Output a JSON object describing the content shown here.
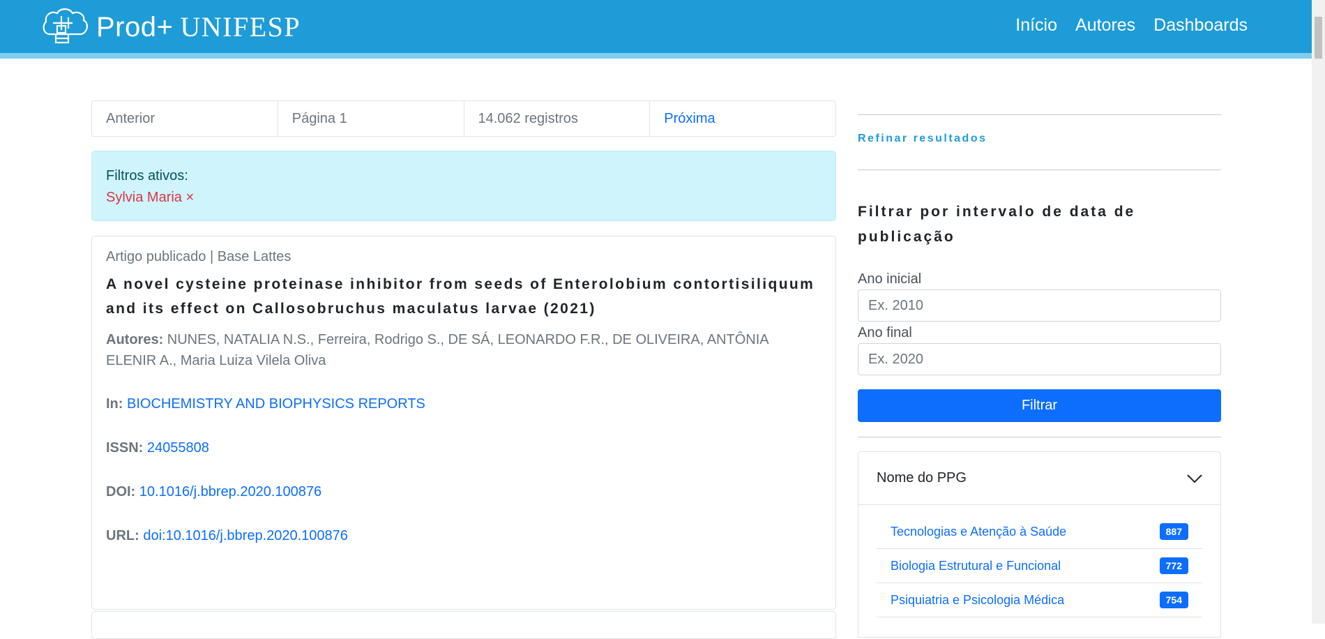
{
  "header": {
    "brand_name": "Prod+",
    "brand_org": "UNIFESP",
    "nav": [
      "Início",
      "Autores",
      "Dashboards"
    ]
  },
  "pager": {
    "previous": "Anterior",
    "page": "Página 1",
    "records": "14.062 registros",
    "next": "Próxima"
  },
  "filters": {
    "label": "Filtros ativos:",
    "active": "Sylvia Maria ×"
  },
  "record": {
    "meta": "Artigo publicado | Base Lattes",
    "title": "A novel cysteine proteinase inhibitor from seeds of Enterolobium contortisiliquum and its effect on Callosobruchus maculatus larvae (2021)",
    "authors_label": "Autores:",
    "authors": "NUNES, NATALIA N.S., Ferreira, Rodrigo S., DE SÁ, LEONARDO F.R., DE OLIVEIRA, ANTÔNIA ELENIR A., Maria Luiza Vilela Oliva",
    "in_label": "In:",
    "in_value": "BIOCHEMISTRY AND BIOPHYSICS REPORTS",
    "issn_label": "ISSN:",
    "issn_value": "24055808",
    "doi_label": "DOI:",
    "doi_value": "10.1016/j.bbrep.2020.100876",
    "url_label": "URL:",
    "url_value": "doi:10.1016/j.bbrep.2020.100876"
  },
  "sidebar": {
    "refine": "Refinar resultados",
    "date_title": "Filtrar por intervalo de data de publicação",
    "start_label": "Ano inicial",
    "start_placeholder": "Ex. 2010",
    "end_label": "Ano final",
    "end_placeholder": "Ex. 2020",
    "filter_button": "Filtrar",
    "ppg_heading": "Nome do PPG",
    "ppg_items": [
      {
        "name": "Tecnologias e Atenção à Saúde",
        "count": "887"
      },
      {
        "name": "Biologia Estrutural e Funcional",
        "count": "772"
      },
      {
        "name": "Psiquiatria e Psicologia Médica",
        "count": "754"
      }
    ]
  },
  "icons": {
    "logo": "brain-logo-icon",
    "accordion": "chevron-down-icon"
  },
  "colors": {
    "header": "#1e9cd7",
    "link": "#0d6efd",
    "alert_bg": "#cff4fc",
    "filter_tag": "#dc3545"
  }
}
